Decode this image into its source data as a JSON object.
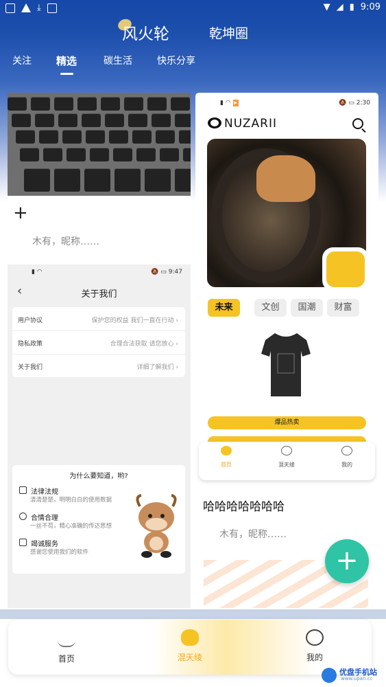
{
  "status_bar": {
    "time": "9:09"
  },
  "header": {
    "brand": "风火轮",
    "circle": "乾坤圈"
  },
  "tabs": [
    {
      "label": "关注"
    },
    {
      "label": "精选"
    },
    {
      "label": "碳生活"
    },
    {
      "label": "快乐分享"
    }
  ],
  "left_post": {
    "nickname": "木有，昵称……",
    "about_screenshot": {
      "time": "9:47",
      "title": "关于我们",
      "rows": [
        {
          "key": "用户协议",
          "value": "保护您的权益 我们一直在行动"
        },
        {
          "key": "隐私政策",
          "value": "合理合法获取 请您放心"
        },
        {
          "key": "关于我们",
          "value": "详细了解我们"
        }
      ],
      "why_title": "为什么要知道，哟?",
      "why_items": [
        {
          "title": "法律法规",
          "sub": "清清楚楚，明明白白的使用数据"
        },
        {
          "title": "合情合理",
          "sub": "一丝不苟，精心准确的传达思想"
        },
        {
          "title": "竭诚服务",
          "sub": "感谢您使用我们的软件"
        }
      ]
    }
  },
  "right_post": {
    "screenshot": {
      "time": "2:30",
      "logo": "NUZARII",
      "chips": [
        "未来",
        "文创",
        "国潮",
        "财富"
      ],
      "hot_label": "爆品热卖",
      "inner_nav": [
        "首页",
        "混天绫",
        "我的"
      ]
    },
    "title": "哈哈哈哈哈哈哈",
    "nickname": "木有，昵称……"
  },
  "fab": {
    "icon": "plus-icon",
    "label": "+"
  },
  "bottom_nav": [
    {
      "label": "首页",
      "icon": "lotus-icon",
      "active": false
    },
    {
      "label": "混天绫",
      "icon": "bear-icon",
      "active": true
    },
    {
      "label": "我的",
      "icon": "smile-icon",
      "active": false
    }
  ],
  "watermark": {
    "name": "优盘手机站",
    "url": "www.upan.cc"
  },
  "colors": {
    "header_blue": "#1548a8",
    "accent_yellow": "#f5c324",
    "fab_green": "#2ec4a5",
    "active_orange": "#f5a623"
  }
}
